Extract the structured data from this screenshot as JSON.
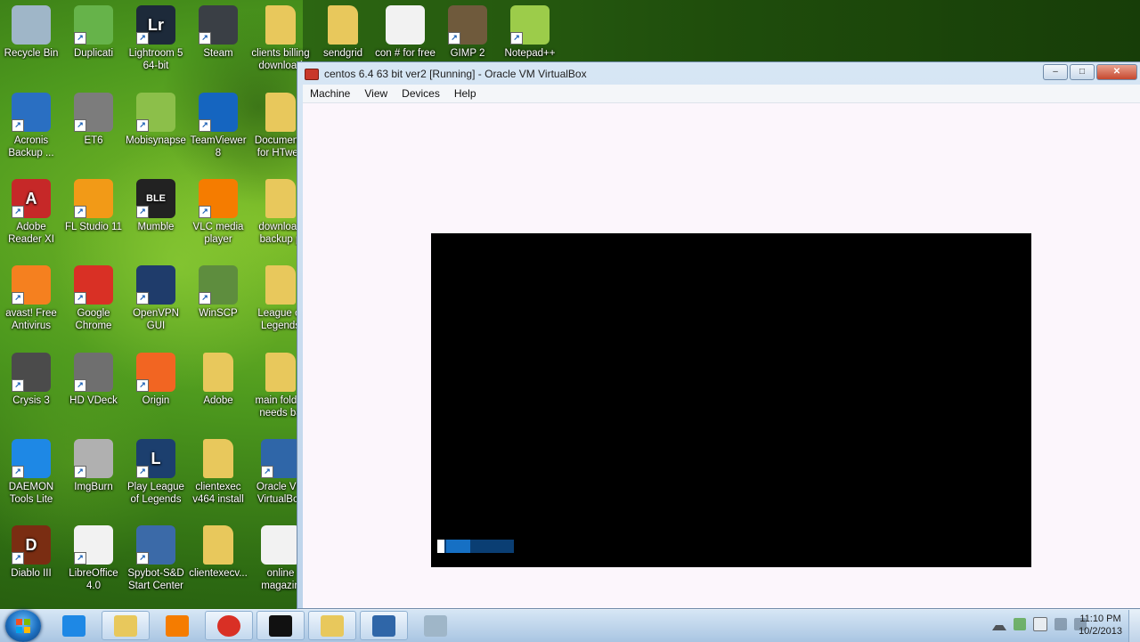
{
  "desktop": {
    "icons": [
      {
        "label": "Recycle Bin",
        "icon": "recycle-bin-icon",
        "color": "#9fb6c8"
      },
      {
        "label": "Duplicati",
        "icon": "duplicati-icon",
        "color": "#66b34a"
      },
      {
        "label": "Lightroom 5 64-bit",
        "icon": "lightroom-icon",
        "color": "#1d2a3a",
        "glyph": "Lr"
      },
      {
        "label": "Steam",
        "icon": "steam-icon",
        "color": "#3a3f45"
      },
      {
        "label": "clients billing download",
        "icon": "folder-icon",
        "color": "#e8c85c"
      },
      {
        "label": "sendgrid",
        "icon": "folder-icon",
        "color": "#e8c85c"
      },
      {
        "label": "con # for free",
        "icon": "document-icon",
        "color": "#f2f2f2"
      },
      {
        "label": "GIMP 2",
        "icon": "gimp-icon",
        "color": "#6f5a3c"
      },
      {
        "label": "Notepad++",
        "icon": "notepad-plus-plus-icon",
        "color": "#9ccc4a"
      },
      {
        "label": "Acronis Backup ...",
        "icon": "acronis-icon",
        "color": "#2a6fc2"
      },
      {
        "label": "ET6",
        "icon": "et6-icon",
        "color": "#7c7c7c"
      },
      {
        "label": "Mobisynapse",
        "icon": "mobisynapse-icon",
        "color": "#8cbf4a"
      },
      {
        "label": "TeamViewer 8",
        "icon": "teamviewer-icon",
        "color": "#1565c0"
      },
      {
        "label": "Documents for HTweb",
        "icon": "folder-icon",
        "color": "#e8c85c"
      },
      {
        "label": "Adobe Reader XI",
        "icon": "adobe-reader-icon",
        "color": "#c62828",
        "glyph": "A"
      },
      {
        "label": "FL Studio 11",
        "icon": "fl-studio-icon",
        "color": "#f29a17"
      },
      {
        "label": "Mumble",
        "icon": "mumble-icon",
        "color": "#222222",
        "glyph": "BLE"
      },
      {
        "label": "VLC media player",
        "icon": "vlc-icon",
        "color": "#f57c00"
      },
      {
        "label": "download backup p",
        "icon": "folder-icon",
        "color": "#e8c85c"
      },
      {
        "label": "avast! Free Antivirus",
        "icon": "avast-icon",
        "color": "#f5801f"
      },
      {
        "label": "Google Chrome",
        "icon": "chrome-icon",
        "color": "#d93025"
      },
      {
        "label": "OpenVPN GUI",
        "icon": "openvpn-icon",
        "color": "#1f3c6b"
      },
      {
        "label": "WinSCP",
        "icon": "winscp-icon",
        "color": "#5e8d3e"
      },
      {
        "label": "League of Legends",
        "icon": "folder-icon",
        "color": "#e8c85c"
      },
      {
        "label": "Crysis 3",
        "icon": "crysis-icon",
        "color": "#4b4b4b"
      },
      {
        "label": "HD VDeck",
        "icon": "hd-vdeck-icon",
        "color": "#6f6f6f"
      },
      {
        "label": "Origin",
        "icon": "origin-icon",
        "color": "#f26522"
      },
      {
        "label": "Adobe",
        "icon": "folder-icon",
        "color": "#e8c85c"
      },
      {
        "label": "main folder needs ba",
        "icon": "folder-icon",
        "color": "#e8c85c"
      },
      {
        "label": "DAEMON Tools Lite",
        "icon": "daemon-tools-icon",
        "color": "#1e88e5"
      },
      {
        "label": "ImgBurn",
        "icon": "imgburn-icon",
        "color": "#b0b0b0"
      },
      {
        "label": "Play League of Legends",
        "icon": "league-icon",
        "color": "#1c3f6e",
        "glyph": "L"
      },
      {
        "label": "clientexec v464 install",
        "icon": "folder-icon",
        "color": "#e8c85c"
      },
      {
        "label": "Oracle VM VirtualBox",
        "icon": "virtualbox-icon",
        "color": "#2f66a8"
      },
      {
        "label": "Diablo III",
        "icon": "diablo-icon",
        "color": "#7a2d12",
        "glyph": "D"
      },
      {
        "label": "LibreOffice 4.0",
        "icon": "libreoffice-icon",
        "color": "#f2f2f2"
      },
      {
        "label": "Spybot-S&D Start Center",
        "icon": "spybot-icon",
        "color": "#3b6aa8"
      },
      {
        "label": "clientexecv...",
        "icon": "folder-icon",
        "color": "#e8c85c"
      },
      {
        "label": "online magazin",
        "icon": "pdf-icon",
        "color": "#f2f2f2"
      }
    ]
  },
  "window": {
    "title": "centos 6.4 63 bit ver2 [Running] - Oracle VM VirtualBox",
    "controls": {
      "minimize": "‒",
      "maximize": "□",
      "close": "✕"
    },
    "menu": [
      "Machine",
      "View",
      "Devices",
      "Help"
    ]
  },
  "vm": {
    "boot_progress": 0.35
  },
  "taskbar": {
    "items": [
      {
        "name": "taskbar-ie",
        "icon": "internet-explorer-icon",
        "color": "#1e88e5",
        "active": false
      },
      {
        "name": "taskbar-explorer",
        "icon": "file-explorer-icon",
        "color": "#e8c85c",
        "active": true
      },
      {
        "name": "taskbar-media-player",
        "icon": "media-player-icon",
        "color": "#f57c00",
        "active": false
      },
      {
        "name": "taskbar-chrome",
        "icon": "chrome-icon",
        "color": "#d93025",
        "active": true
      },
      {
        "name": "taskbar-cmd",
        "icon": "command-prompt-icon",
        "color": "#111111",
        "active": true
      },
      {
        "name": "taskbar-folder",
        "icon": "folder-icon",
        "color": "#e8c85c",
        "active": true
      },
      {
        "name": "taskbar-virtualbox",
        "icon": "virtualbox-icon",
        "color": "#2f66a8",
        "active": true
      },
      {
        "name": "taskbar-calculator",
        "icon": "calculator-icon",
        "color": "#9fb6c8",
        "active": false
      }
    ],
    "clock": {
      "time": "11:10 PM",
      "date": "10/2/2013"
    }
  }
}
